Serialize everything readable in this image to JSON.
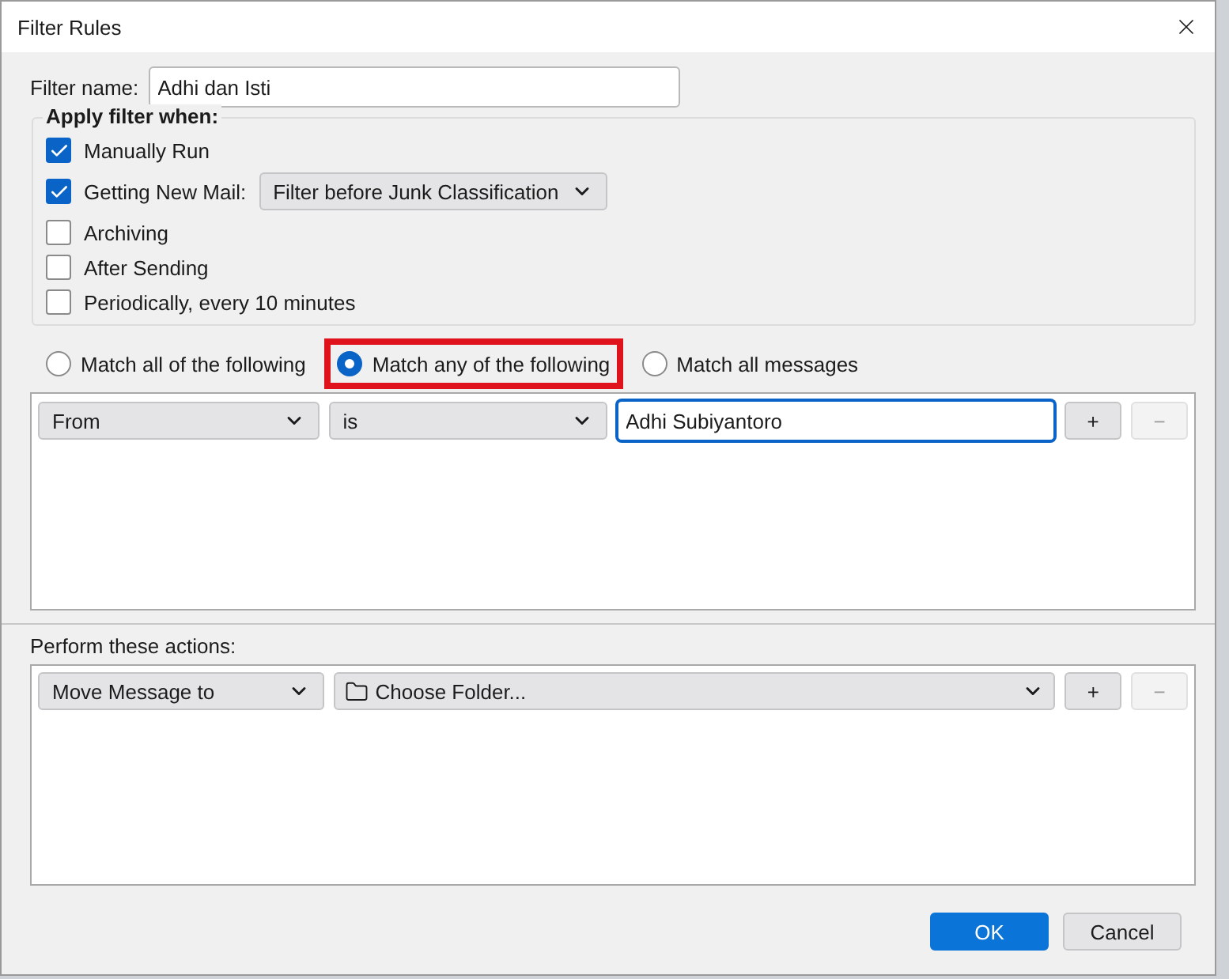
{
  "window": {
    "title": "Filter Rules"
  },
  "filter_name": {
    "label": "Filter name:",
    "value": "Adhi dan Isti"
  },
  "apply_when": {
    "legend": "Apply filter when:",
    "options": [
      {
        "label": "Manually Run",
        "checked": true
      },
      {
        "label": "Getting New Mail:",
        "checked": true,
        "dropdown": "Filter before Junk Classification"
      },
      {
        "label": "Archiving",
        "checked": false
      },
      {
        "label": "After Sending",
        "checked": false
      },
      {
        "label": "Periodically, every 10 minutes",
        "checked": false
      }
    ]
  },
  "match": [
    {
      "label": "Match all of the following",
      "selected": false,
      "highlighted": false
    },
    {
      "label": "Match any of the following",
      "selected": true,
      "highlighted": true
    },
    {
      "label": "Match all messages",
      "selected": false,
      "highlighted": false
    }
  ],
  "conditions": [
    {
      "field": "From",
      "operator": "is",
      "value": "Adhi Subiyantoro",
      "add": "+",
      "remove": "−"
    }
  ],
  "actions_label": "Perform these actions:",
  "actions": [
    {
      "action": "Move Message to",
      "target": "Choose Folder...",
      "add": "+",
      "remove": "−"
    }
  ],
  "buttons": [
    {
      "label": "OK",
      "kind": "primary"
    },
    {
      "label": "Cancel",
      "kind": "secondary"
    }
  ]
}
